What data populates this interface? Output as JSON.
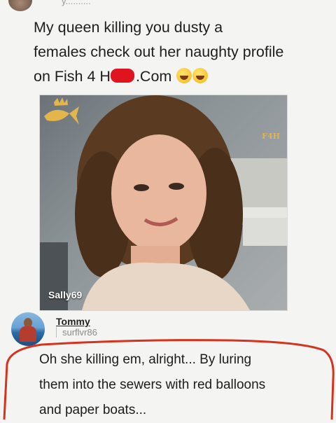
{
  "top": {
    "handle": "y.........."
  },
  "post": {
    "line1": "My queen killing you dusty a",
    "line2": "females check out her naughty profile",
    "line3_pre": "on Fish 4 H",
    "line3_post": ".Com"
  },
  "photo": {
    "watermark_text": "F4H",
    "username": "Sally69"
  },
  "reply": {
    "name": "Tommy",
    "handle": "surflvr86",
    "line1": "Oh she killing em, alright... By luring",
    "line2": "them into the sewers with red balloons",
    "line3": "and paper boats..."
  },
  "colors": {
    "redaction": "#e0141e",
    "annotation_circle": "#d2341f",
    "watermark": "#e3b54a"
  }
}
